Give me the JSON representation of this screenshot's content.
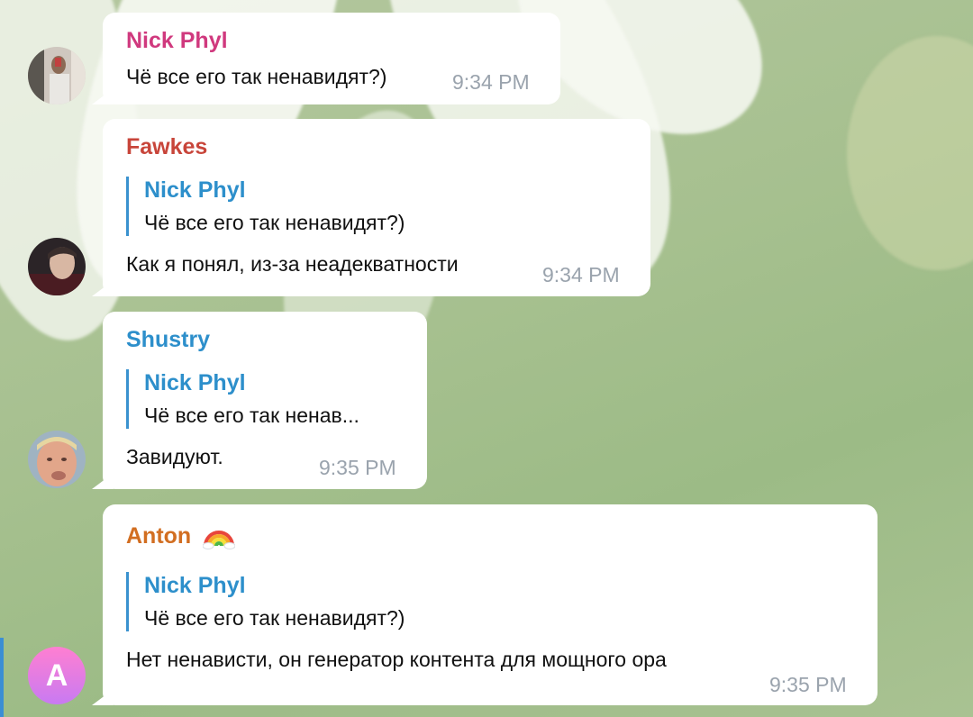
{
  "colors": {
    "nick": "#d0397e",
    "fawkes": "#c8453a",
    "shustry": "#2d8fcb",
    "anton": "#d26e21",
    "reply": "#2d8fcb",
    "time": "#9aa3ad"
  },
  "messages": [
    {
      "author": "Nick Phyl",
      "text": "Чё все его так ненавидят?)",
      "time": "9:34 PM",
      "avatar_icon": "person-photo-avatar"
    },
    {
      "author": "Fawkes",
      "reply": {
        "author": "Nick Phyl",
        "text": "Чё все его так ненавидят?)"
      },
      "text": "Как я понял, из-за неадекватности",
      "time": "9:34 PM",
      "avatar_icon": "person-photo-avatar"
    },
    {
      "author": "Shustry",
      "reply": {
        "author": "Nick Phyl",
        "text": "Чё все его так ненав..."
      },
      "text": "Завидуют.",
      "time": "9:35 PM",
      "avatar_icon": "person-photo-avatar"
    },
    {
      "author": "Anton",
      "author_emoji": "rainbow-icon",
      "reply": {
        "author": "Nick Phyl",
        "text": "Чё все его так ненавидят?)"
      },
      "text": "Нет ненависти, он генератор контента для мощного ора",
      "time": "9:35 PM",
      "avatar_letter": "A"
    }
  ]
}
